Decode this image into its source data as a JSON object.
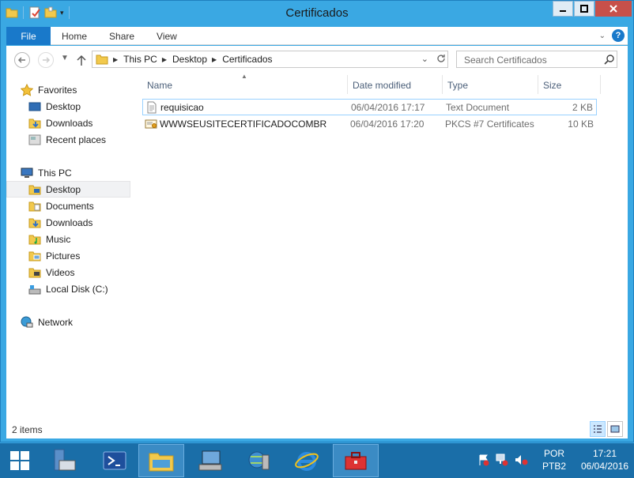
{
  "window": {
    "title": "Certificados"
  },
  "ribbon": {
    "tabs": [
      "File",
      "Home",
      "Share",
      "View"
    ]
  },
  "address": {
    "crumbs": [
      "This PC",
      "Desktop",
      "Certificados"
    ],
    "search_placeholder": "Search Certificados"
  },
  "sidebar": {
    "favorites_label": "Favorites",
    "favorites": [
      "Desktop",
      "Downloads",
      "Recent places"
    ],
    "thispc_label": "This PC",
    "thispc": [
      "Desktop",
      "Documents",
      "Downloads",
      "Music",
      "Pictures",
      "Videos",
      "Local Disk (C:)"
    ],
    "network_label": "Network"
  },
  "filelist": {
    "columns": [
      "Name",
      "Date modified",
      "Type",
      "Size"
    ],
    "rows": [
      {
        "name": "requisicao",
        "date": "06/04/2016 17:17",
        "type": "Text Document",
        "size": "2 KB",
        "icon": "text-file-icon"
      },
      {
        "name": "WWWSEUSITECERTIFICADOCOMBR",
        "date": "06/04/2016 17:20",
        "type": "PKCS #7 Certificates",
        "size": "10 KB",
        "icon": "certificate-icon"
      }
    ]
  },
  "status": {
    "item_count": "2 items"
  },
  "taskbar": {
    "lang_top": "POR",
    "lang_bottom": "PTB2",
    "time": "17:21",
    "date": "06/04/2016"
  }
}
